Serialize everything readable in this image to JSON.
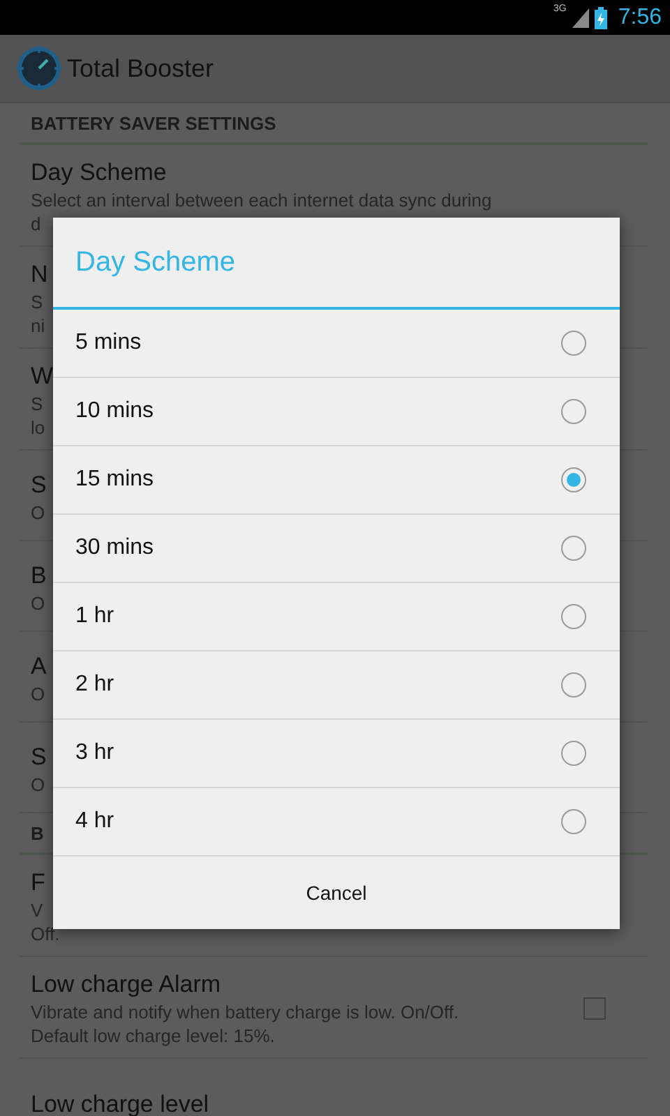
{
  "status_bar": {
    "network": "3G",
    "time": "7:56"
  },
  "app_bar": {
    "title": "Total Booster"
  },
  "settings": [
    {
      "kind": "header",
      "title": "BATTERY SAVER SETTINGS"
    },
    {
      "kind": "item",
      "title": "Day Scheme",
      "lines": [
        "Select an interval between each internet data sync during",
        "d"
      ]
    },
    {
      "kind": "item",
      "title": "N",
      "lines": [
        "S",
        "ni"
      ]
    },
    {
      "kind": "item",
      "title": "W",
      "lines": [
        "S",
        "lo"
      ]
    },
    {
      "kind": "item",
      "title": "S",
      "lines": [
        "O"
      ]
    },
    {
      "kind": "item",
      "title": "B",
      "lines": [
        "O"
      ]
    },
    {
      "kind": "item",
      "title": "A",
      "lines": [
        "O"
      ]
    },
    {
      "kind": "item",
      "title": "S",
      "lines": [
        "O"
      ]
    },
    {
      "kind": "header",
      "title": "B"
    },
    {
      "kind": "item",
      "title": "F",
      "lines": [
        "V",
        "Off."
      ]
    },
    {
      "kind": "check",
      "title": "Low charge Alarm",
      "lines": [
        "Vibrate and notify when battery charge is low. On/Off.",
        "Default low charge level: 15%."
      ],
      "checked": false
    },
    {
      "kind": "item",
      "title": "Low charge level"
    }
  ],
  "dialog": {
    "title": "Day Scheme",
    "options": [
      {
        "label": "5 mins",
        "selected": false
      },
      {
        "label": "10 mins",
        "selected": false
      },
      {
        "label": "15 mins",
        "selected": true
      },
      {
        "label": "30 mins",
        "selected": false
      },
      {
        "label": "1 hr",
        "selected": false
      },
      {
        "label": "2 hr",
        "selected": false
      },
      {
        "label": "3 hr",
        "selected": false
      },
      {
        "label": "4 hr",
        "selected": false
      }
    ],
    "button": "Cancel"
  }
}
